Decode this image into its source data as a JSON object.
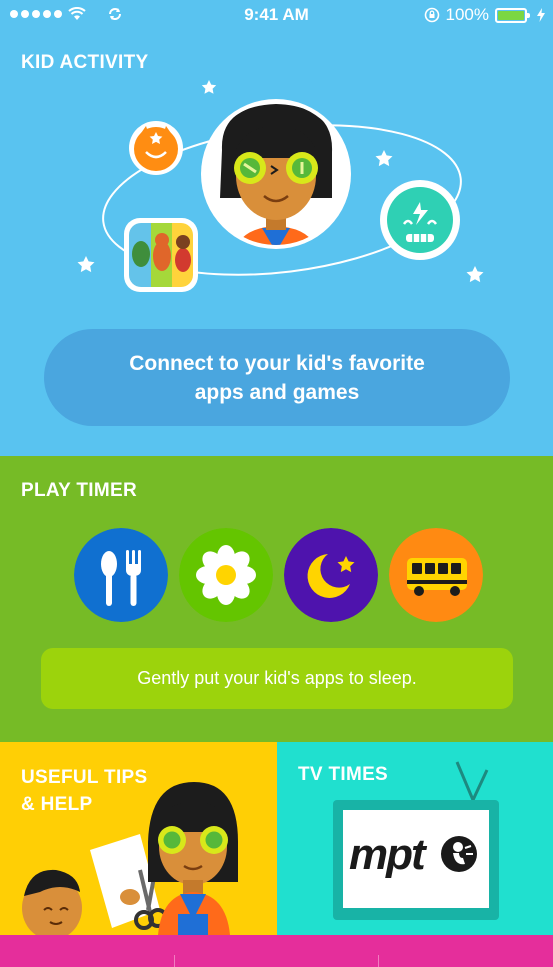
{
  "status_bar": {
    "time": "9:41 AM",
    "battery": "100%",
    "icons": [
      "signal-dots-icon",
      "wifi-icon",
      "sync-icon",
      "rotation-lock-icon",
      "battery-icon",
      "charging-icon"
    ]
  },
  "kid_activity": {
    "title": "KID ACTIVITY",
    "button": "Connect to your kid's favorite\napps and games",
    "illustration_icons": [
      "kid-avatar-icon",
      "orange-fox-icon",
      "robot-icon",
      "cartoon-app-icon",
      "star-icon"
    ]
  },
  "play_timer": {
    "title": "PLAY TIMER",
    "icons": [
      {
        "name": "meal-icon",
        "color": "#1070d0"
      },
      {
        "name": "flower-icon",
        "color": "#64c500"
      },
      {
        "name": "moon-icon",
        "color": "#4e13ad"
      },
      {
        "name": "school-bus-icon",
        "color": "#ff8a12"
      }
    ],
    "sleep_button": "Gently put your kid's apps to sleep."
  },
  "useful_tips": {
    "title": "USEFUL TIPS\n& HELP"
  },
  "tv_times": {
    "title": "TV TIMES",
    "logo": "mpt"
  },
  "colors": {
    "kid_bg": "#59c3f0",
    "timer_bg": "#76bb26",
    "tips_bg": "#ffcf05",
    "tv_bg": "#20e0cf",
    "strip_bg": "#e52e9b"
  }
}
